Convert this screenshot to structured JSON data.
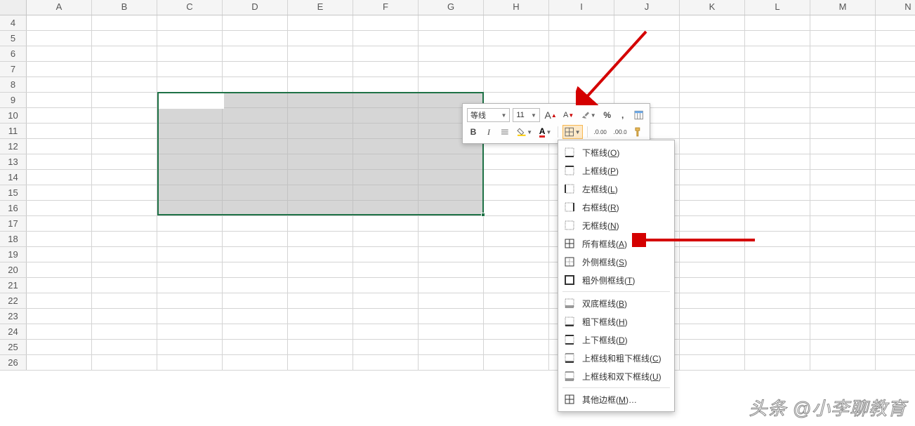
{
  "columns": [
    "A",
    "B",
    "C",
    "D",
    "E",
    "F",
    "G",
    "H",
    "I",
    "J",
    "K",
    "L",
    "M",
    "N"
  ],
  "rows": [
    4,
    5,
    6,
    7,
    8,
    9,
    10,
    11,
    12,
    13,
    14,
    15,
    16,
    17,
    18,
    19,
    20,
    21,
    22,
    23,
    24,
    25,
    26
  ],
  "selection": {
    "from": "C9",
    "to": "G16"
  },
  "mini_toolbar": {
    "font_name": "等线",
    "font_size": "11",
    "increase_font_tip": "A↑",
    "decrease_font_tip": "A↓"
  },
  "border_menu": {
    "items": [
      {
        "icon": "border-bottom",
        "label": "下框线",
        "shortcut": "O"
      },
      {
        "icon": "border-top",
        "label": "上框线",
        "shortcut": "P"
      },
      {
        "icon": "border-left",
        "label": "左框线",
        "shortcut": "L"
      },
      {
        "icon": "border-right",
        "label": "右框线",
        "shortcut": "R"
      },
      {
        "icon": "border-none",
        "label": "无框线",
        "shortcut": "N"
      },
      {
        "icon": "border-all",
        "label": "所有框线",
        "shortcut": "A"
      },
      {
        "icon": "border-outside",
        "label": "外侧框线",
        "shortcut": "S"
      },
      {
        "icon": "border-thick",
        "label": "粗外侧框线",
        "shortcut": "T"
      },
      {
        "sep": true
      },
      {
        "icon": "border-dbl-bottom",
        "label": "双底框线",
        "shortcut": "B"
      },
      {
        "icon": "border-thick-bottom",
        "label": "粗下框线",
        "shortcut": "H"
      },
      {
        "icon": "border-top-bottom",
        "label": "上下框线",
        "shortcut": "D"
      },
      {
        "icon": "border-top-thickb",
        "label": "上框线和粗下框线",
        "shortcut": "C"
      },
      {
        "icon": "border-top-dblb",
        "label": "上框线和双下框线",
        "shortcut": "U"
      },
      {
        "sep": true
      },
      {
        "icon": "border-more",
        "label": "其他边框",
        "shortcut": "M",
        "trail": "…"
      }
    ]
  },
  "watermark": "头条 @小李聊教育"
}
